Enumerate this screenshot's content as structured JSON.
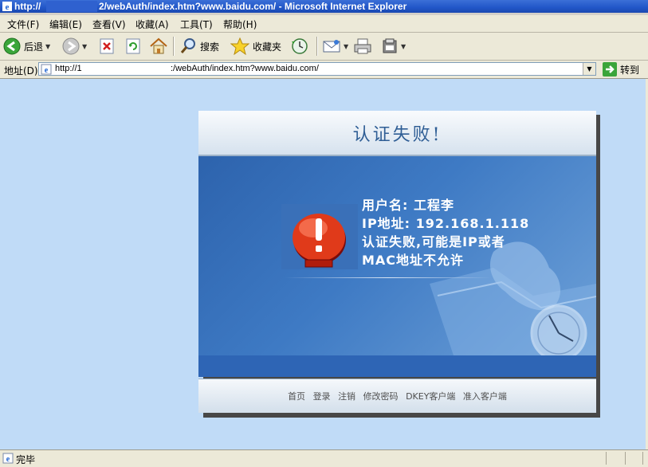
{
  "window": {
    "title_prefix": "http://",
    "title_suffix": "2/webAuth/index.htm?www.baidu.com/ - Microsoft Internet Explorer"
  },
  "menu": {
    "file": "文件(F)",
    "edit": "编辑(E)",
    "view": "查看(V)",
    "favorites": "收藏(A)",
    "tools": "工具(T)",
    "help": "帮助(H)"
  },
  "toolbar": {
    "back": "后退",
    "search": "搜索",
    "favorites": "收藏夹"
  },
  "address": {
    "label": "地址(D)",
    "url_prefix": "http://1",
    "url_suffix": ":/webAuth/index.htm?www.baidu.com/",
    "go": "转到"
  },
  "panel": {
    "title": "认证失败!",
    "lines": [
      "用户名: 工程李",
      "IP地址: 192.168.1.118",
      "认证失败,可能是IP或者",
      "MAC地址不允许"
    ],
    "footer_links": [
      "首页",
      "登录",
      "注销",
      "修改密码",
      "DKEY客户端",
      "准入客户端"
    ]
  },
  "status": {
    "text": "完毕"
  },
  "colors": {
    "title_bar": "#2156c8",
    "page_bg": "#c0dbf7",
    "panel_title": "#2f5e95",
    "panel_body": "#3e7ac4"
  }
}
